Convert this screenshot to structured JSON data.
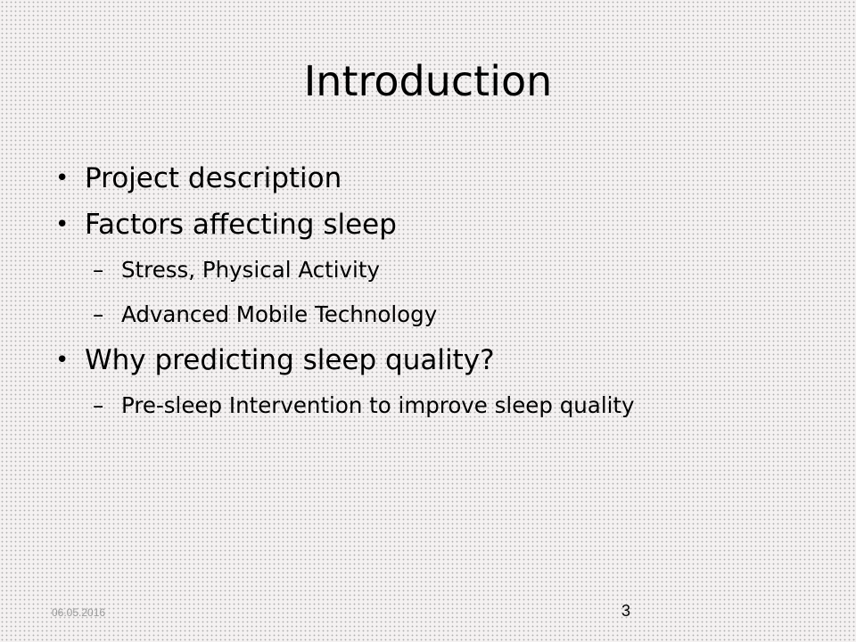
{
  "slide": {
    "title": "Introduction",
    "bullets": [
      {
        "text": "Project description"
      },
      {
        "text": "Factors affecting sleep"
      },
      {
        "sub": "Stress, Physical Activity"
      },
      {
        "sub": "Advanced Mobile Technology"
      },
      {
        "text": "Why predicting sleep quality?"
      },
      {
        "sub": "Pre-sleep Intervention to improve sleep quality"
      }
    ],
    "footer": {
      "date": "06.05.2016",
      "page_number": "3"
    }
  },
  "colors": {
    "background": "#f4f1f1",
    "text": "#000000",
    "footer_date": "#9a9a9a"
  }
}
